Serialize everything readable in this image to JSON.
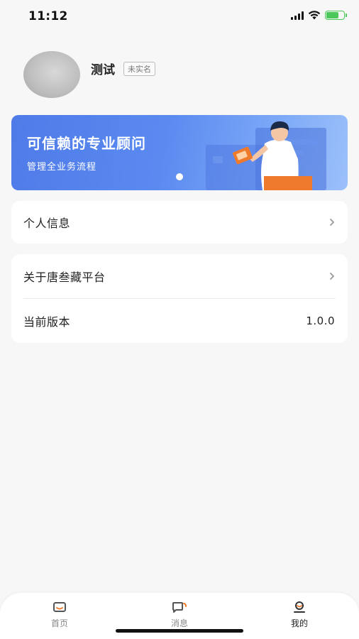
{
  "status_bar": {
    "time": "11:12"
  },
  "profile": {
    "name": "测试",
    "verify_status": "未实名"
  },
  "banner": {
    "title": "可信赖的专业顾问",
    "subtitle": "管理全业务流程"
  },
  "menu_group_1": {
    "items": [
      {
        "label": "个人信息"
      }
    ]
  },
  "menu_group_2": {
    "items": [
      {
        "label": "关于唐叁藏平台"
      },
      {
        "label": "当前版本",
        "value": "1.0.0"
      }
    ]
  },
  "tabbar": {
    "tabs": [
      {
        "label": "首页",
        "icon": "home-icon"
      },
      {
        "label": "消息",
        "icon": "message-icon"
      },
      {
        "label": "我的",
        "icon": "profile-icon",
        "active": true
      }
    ]
  },
  "colors": {
    "accent": "#f07a2c",
    "banner_start": "#4f7be8",
    "banner_end": "#9cc0fa",
    "background": "#f7f7f8"
  }
}
